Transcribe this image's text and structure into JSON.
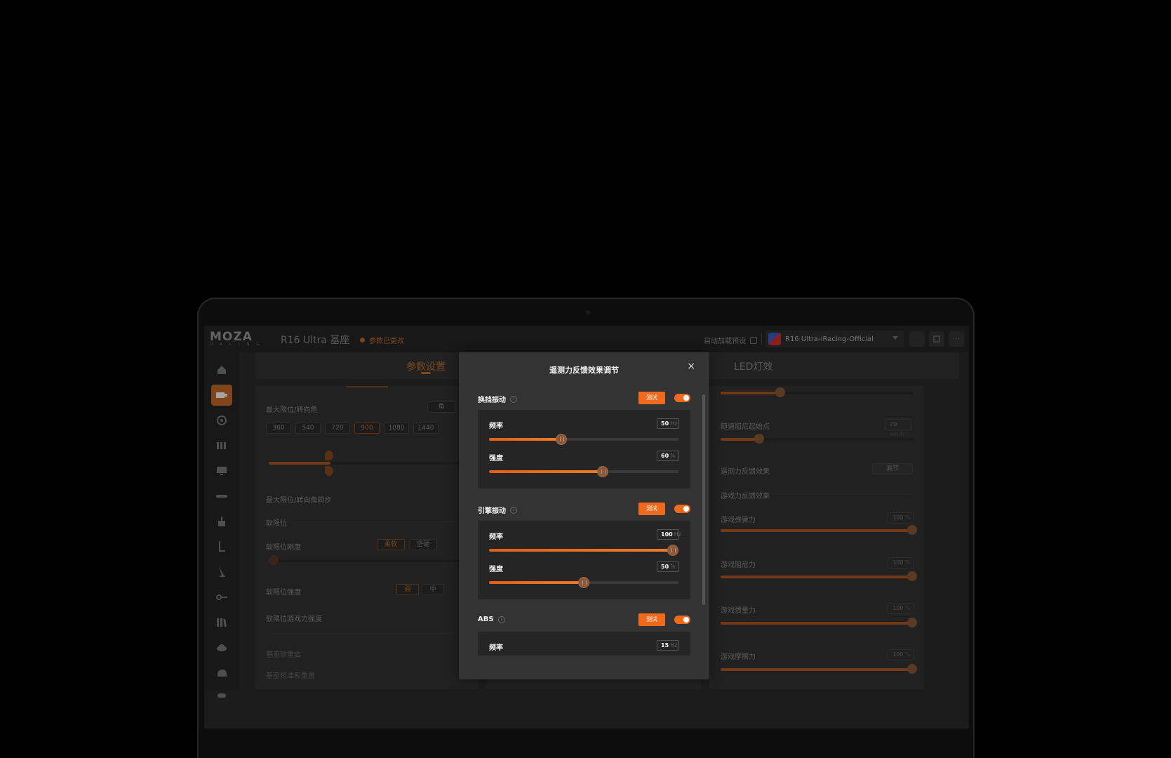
{
  "app": {
    "logo_main": "MOZA",
    "logo_sub": "RACING",
    "device_title": "R16 Ultra 基座",
    "changed_status": "参数已更改",
    "autoload_label": "自动加载预设",
    "preset_name": "R16 Ultra-iRacing-Official",
    "more_icon": "···"
  },
  "sidebar": {
    "items": [
      "home-icon",
      "wheelbase-icon",
      "steering-wheel-icon",
      "pedals-icon",
      "dashboard-icon",
      "shifter-icon",
      "handbrake-icon",
      "pedal-icon",
      "pedal-2-icon",
      "hub-icon",
      "library-icon",
      "cloud-icon",
      "helmet-icon",
      "more-icon"
    ]
  },
  "tabs": {
    "params": "参数设置",
    "partial": "置",
    "led": "LED灯效"
  },
  "left_panel": {
    "max_angle_label": "最大限位/转向角",
    "angle_partial": "角",
    "angle_options": [
      "360",
      "540",
      "720",
      "900",
      "1080",
      "1440"
    ],
    "angle_selected": "900",
    "sync_label": "最大限位/转向角同步",
    "soft_limit_label": "软限位",
    "soft_limit_stiffness_label": "软限位刚度",
    "stiffness_options": [
      "柔软",
      "坚硬"
    ],
    "soft_limit_strength_label": "软限位强度",
    "strength_options": [
      "弱",
      "中"
    ],
    "soft_limit_game_label": "软限位游戏力强度",
    "soft_restart_label": "基座软重启",
    "calibrate_label": "基座校准和重置"
  },
  "right_panel": {
    "speed_damping_label": "随速阻尼起始点",
    "speed_damping_value": "70",
    "speed_damping_unit": "km/h",
    "telemetry_label": "遥测力反馈效果",
    "telemetry_button": "调节",
    "game_ffb_label": "游戏力反馈效果",
    "game_items": [
      {
        "label": "游戏弹簧力",
        "value": "100",
        "unit": "%"
      },
      {
        "label": "游戏阻尼力",
        "value": "100",
        "unit": "%"
      },
      {
        "label": "游戏惯量力",
        "value": "100",
        "unit": "%"
      },
      {
        "label": "游戏摩擦力",
        "value": "100",
        "unit": "%"
      }
    ]
  },
  "dialog": {
    "title": "遥测力反馈效果调节",
    "close_icon": "×",
    "test_label": "测试",
    "sections": [
      {
        "name": "换挡振动",
        "freq_label": "频率",
        "freq_value": "50",
        "freq_unit": "Hz",
        "freq_fraction": 0.38,
        "strength_label": "强度",
        "strength_value": "60",
        "strength_unit": "%",
        "strength_fraction": 0.6
      },
      {
        "name": "引擎振动",
        "freq_label": "频率",
        "freq_value": "100",
        "freq_unit": "Hz",
        "freq_fraction": 0.97,
        "strength_label": "强度",
        "strength_value": "50",
        "strength_unit": "%",
        "strength_fraction": 0.5
      },
      {
        "name": "ABS",
        "freq_label": "频率",
        "freq_value": "15",
        "freq_unit": "Hz"
      }
    ]
  },
  "colors": {
    "accent": "#f06a1e",
    "accent_dim": "#c06c2a",
    "panel": "#333333",
    "background": "#000000"
  }
}
